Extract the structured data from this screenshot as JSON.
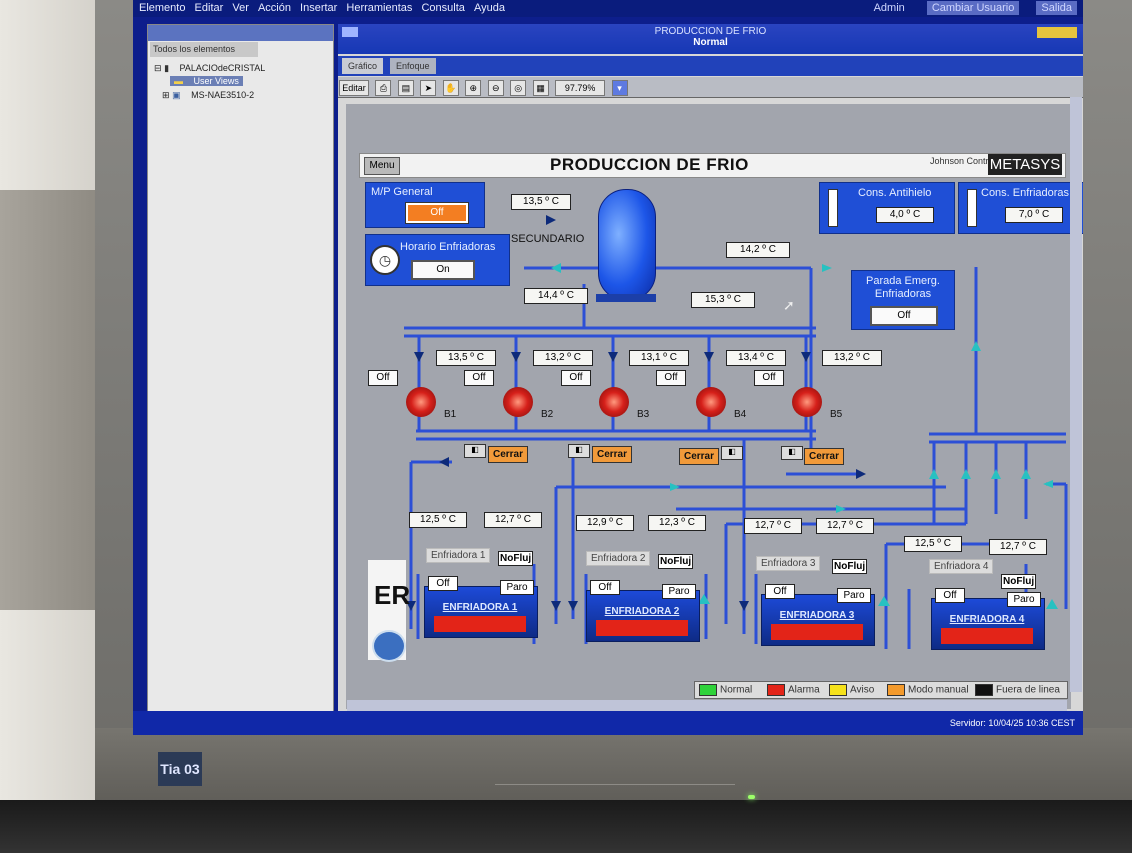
{
  "menubar": {
    "items": [
      "Elemento",
      "Editar",
      "Ver",
      "Acción",
      "Insertar",
      "Herramientas",
      "Consulta",
      "Ayuda"
    ],
    "user": "Admin",
    "change_user": "Cambiar Usuario",
    "exit": "Salida"
  },
  "tree": {
    "tab": "Todos los elementos",
    "items": [
      "PALACIOdeCRISTAL",
      "User Views",
      "MS-NAE3510-2"
    ]
  },
  "window": {
    "title": "PRODUCCION DE FRIO",
    "subtitle": "Normal",
    "tabs": [
      "Gráfico",
      "Enfoque"
    ],
    "edit": "Editar",
    "zoom": "97.79%"
  },
  "scada": {
    "menu_button": "Menu",
    "page_title": "PRODUCCION DE FRIO",
    "brand": "Johnson Controls",
    "logo": "METASYS",
    "mp_general": {
      "label": "M/P General",
      "value": "Off"
    },
    "horario": {
      "label": "Horario Enfriadoras",
      "value": "On"
    },
    "cons_antihielo": {
      "label": "Cons. Antihielo",
      "value": "4,0 º C"
    },
    "cons_enfriadoras": {
      "label": "Cons. Enfriadoras",
      "value": "7,0 º C"
    },
    "parada": {
      "label": "Parada Emerg. Enfriadoras",
      "value": "Off"
    },
    "secundario": "SECUNDARIO",
    "temps": {
      "t_top": "13,5 º C",
      "t_right": "14,2 º C",
      "t_bottom_left": "14,4 º C",
      "t_bottom_right": "15,3 º C"
    },
    "pumps": [
      {
        "name": "B1",
        "temp": "13,5 º C",
        "state": "Off"
      },
      {
        "name": "B2",
        "temp": "13,2 º C",
        "state": "Off"
      },
      {
        "name": "B3",
        "temp": "13,1 º C",
        "state": "Off"
      },
      {
        "name": "B4",
        "temp": "13,4 º C",
        "state": "Off"
      },
      {
        "name": "B5",
        "temp": "13,2 º C",
        "state": "Off"
      }
    ],
    "valves": [
      "Cerrar",
      "Cerrar",
      "Cerrar",
      "Cerrar"
    ],
    "chillers": [
      {
        "label": "Enfriadora 1",
        "name": "ENFRIADORA 1",
        "t_in": "12,5 º C",
        "t_out": "12,7 º C",
        "flow": "NoFluj",
        "state": "Off",
        "mode": "Paro"
      },
      {
        "label": "Enfriadora 2",
        "name": "ENFRIADORA 2",
        "t_in": "12,9 º C",
        "t_out": "12,3 º C",
        "flow": "NoFluj",
        "state": "Off",
        "mode": "Paro"
      },
      {
        "label": "Enfriadora 3",
        "name": "ENFRIADORA 3",
        "t_in": "12,7 º C",
        "t_out": "12,7 º C",
        "flow": "NoFluj",
        "state": "Off",
        "mode": "Paro"
      },
      {
        "label": "Enfriadora 4",
        "name": "ENFRIADORA 4",
        "t_in": "12,5 º C",
        "t_out": "12,7 º C",
        "flow": "NoFluj",
        "state": "Off",
        "mode": "Paro"
      }
    ],
    "legend": [
      {
        "label": "Normal",
        "color": "#2fd23a"
      },
      {
        "label": "Alarma",
        "color": "#e32418"
      },
      {
        "label": "Aviso",
        "color": "#f6e21b"
      },
      {
        "label": "Modo manual",
        "color": "#f39a2c"
      },
      {
        "label": "Fuera de linea",
        "color": "#111111"
      }
    ]
  },
  "status": {
    "server": "Servidor: 10/04/25 10:36 CEST"
  },
  "monitor_badge": "Tia 03"
}
